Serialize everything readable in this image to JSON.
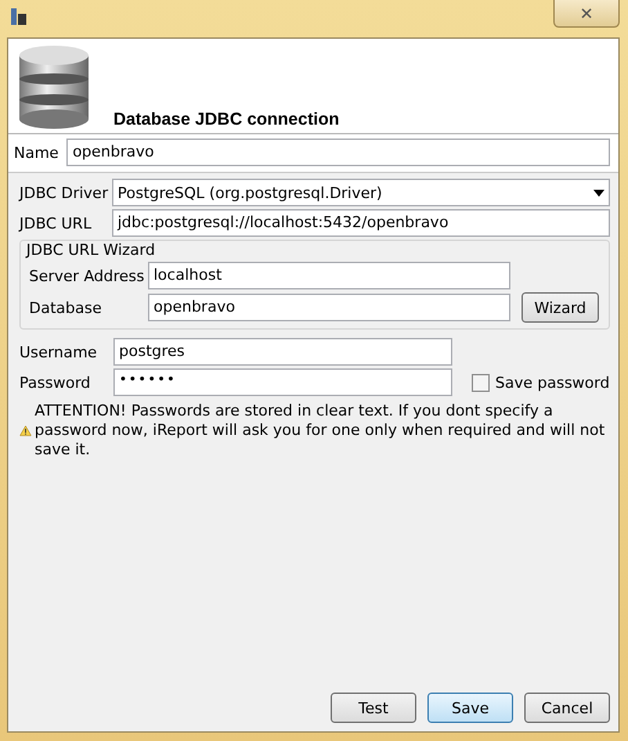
{
  "window": {
    "close": "✕"
  },
  "header": {
    "title": "Database JDBC connection"
  },
  "name": {
    "label": "Name",
    "value": "openbravo"
  },
  "driver": {
    "label": "JDBC Driver",
    "value": "PostgreSQL (org.postgresql.Driver)"
  },
  "url": {
    "label": "JDBC URL",
    "value": "jdbc:postgresql://localhost:5432/openbravo"
  },
  "wizard": {
    "title": "JDBC URL Wizard",
    "server_label": "Server Address",
    "server_value": "localhost",
    "database_label": "Database",
    "database_value": "openbravo",
    "button": "Wizard"
  },
  "username": {
    "label": "Username",
    "value": "postgres"
  },
  "password": {
    "label": "Password",
    "value": "••••••"
  },
  "save_password": {
    "label": "Save password",
    "checked": false
  },
  "warning": "ATTENTION! Passwords are stored in clear text. If you dont specify a password now, iReport will ask you for one only when required and will not save it.",
  "buttons": [
    {
      "label": "Test",
      "selected": false
    },
    {
      "label": "Save",
      "selected": true
    },
    {
      "label": "Cancel",
      "selected": false
    }
  ]
}
